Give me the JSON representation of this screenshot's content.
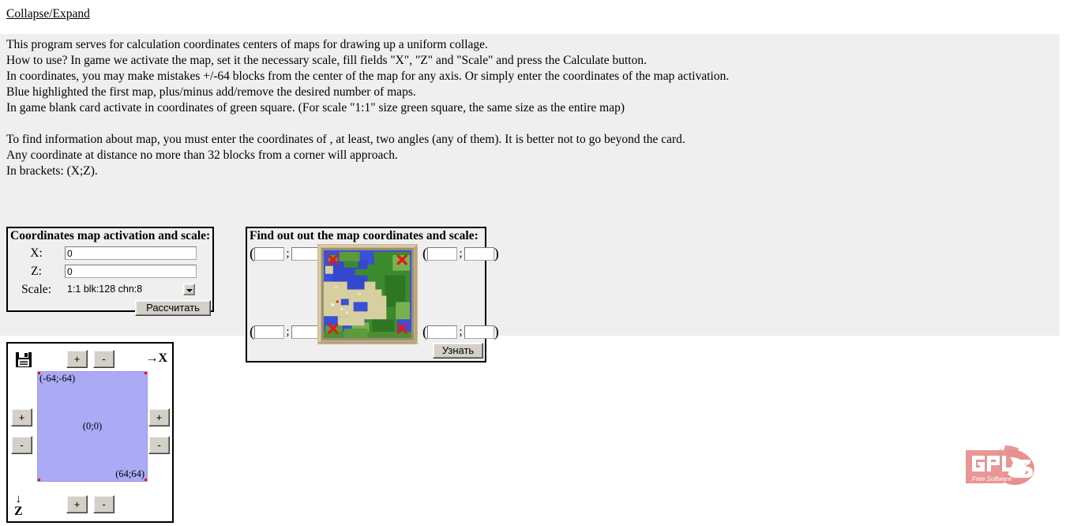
{
  "collapse_link": "Collapse/Expand",
  "help": {
    "lines": [
      "This program serves for calculation coordinates centers of maps for drawing up a uniform collage.",
      "How to use? In game we activate the map, set it the necessary scale, fill fields \"X\", \"Z\" and \"Scale\" and press the Calculate button.",
      "In coordinates, you may make mistakes +/-64 blocks from the center of the map for any axis. Or simply enter the coordinates of the map activation.",
      "Blue highlighted the first map, plus/minus add/remove the desired number of maps.",
      "In game blank card activate in coordinates of green square. (For scale \"1:1\" size green square, the same size as the entire map)",
      "",
      "To find information about map, you must enter the coordinates of , at least, two angles (any of them). It is better not to go beyond the card.",
      "Any coordinate at distance no more than 32 blocks from a corner will approach.",
      "In brackets: (X;Z)."
    ]
  },
  "calc_panel": {
    "title": "Coordinates map activation and scale:",
    "x_label": "X:",
    "x_value": "0",
    "z_label": "Z:",
    "z_value": "0",
    "scale_label": "Scale:",
    "scale_value": "1:1 blk:128 chn:8",
    "scale_options": [
      "1:1 blk:128 chn:8"
    ],
    "calculate_button": "Рассчитать"
  },
  "find_panel": {
    "title": "Find out out the map coordinates and scale:",
    "open_paren": "(",
    "close_paren": ")",
    "separator": ";",
    "corners": {
      "top_left": {
        "x": "",
        "z": ""
      },
      "top_right": {
        "x": "",
        "z": ""
      },
      "bottom_left": {
        "x": "",
        "z": ""
      },
      "bottom_right": {
        "x": "",
        "z": ""
      }
    },
    "find_button": "Узнать",
    "map_thumb_alt": "minecraft-map-thumbnail"
  },
  "grid_panel": {
    "save_icon": "floppy-save-icon",
    "axis_x_label": "→X",
    "axis_z_arrow": "↓",
    "axis_z_label": "Z",
    "plus": "+",
    "minus": "-",
    "square": {
      "top_left_label": "(-64;-64)",
      "center_label": "(0;0)",
      "bottom_right_label": "(64;64)",
      "fill_color": "#aaaaf5",
      "corner_color": "#ff0000"
    }
  },
  "logo": {
    "name": "gpl-v3-free-software-logo",
    "title": "GPL",
    "subtitle": "Free Software",
    "version": "3",
    "color": "#e79090"
  },
  "colors": {
    "page_background": "#ffffff",
    "panel_background": "#efefef",
    "button_face": "#d4d0c8",
    "text": "#000000"
  }
}
